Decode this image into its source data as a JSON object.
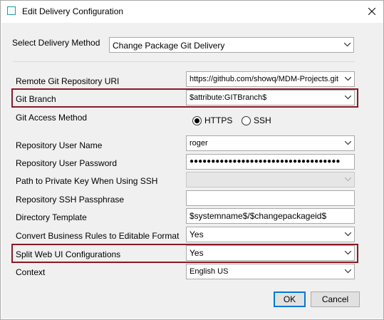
{
  "window": {
    "title": "Edit Delivery Configuration"
  },
  "delivery_method": {
    "label": "Select Delivery Method",
    "value": "Change Package Git Delivery"
  },
  "fields": {
    "repo_uri": {
      "label": "Remote Git Repository URI",
      "value": "https://github.com/showq/MDM-Projects.git"
    },
    "git_branch": {
      "label": "Git Branch",
      "value": "$attribute:GITBranch$"
    },
    "access_method": {
      "label": "Git Access Method",
      "options": [
        "HTTPS",
        "SSH"
      ],
      "selected": "HTTPS"
    },
    "user_name": {
      "label": "Repository User Name",
      "value": "roger"
    },
    "user_password": {
      "label": "Repository User Password",
      "value": "●●●●●●●●●●●●●●●●●●●●●●●●●●●●●●●●●●●"
    },
    "private_key_path": {
      "label": "Path to Private Key When Using SSH",
      "value": ""
    },
    "ssh_passphrase": {
      "label": "Repository SSH Passphrase",
      "value": ""
    },
    "directory_template": {
      "label": "Directory Template",
      "value": "$systemname$/$changepackageid$"
    },
    "convert_business_rules": {
      "label": "Convert Business Rules to Editable Format",
      "value": "Yes"
    },
    "split_web_ui": {
      "label": "Split Web UI Configurations",
      "value": "Yes"
    },
    "context": {
      "label": "Context",
      "value": "English US"
    }
  },
  "buttons": {
    "ok": "OK",
    "cancel": "Cancel"
  },
  "colors": {
    "highlight": "#8b1a24",
    "accent": "#0078d7"
  }
}
